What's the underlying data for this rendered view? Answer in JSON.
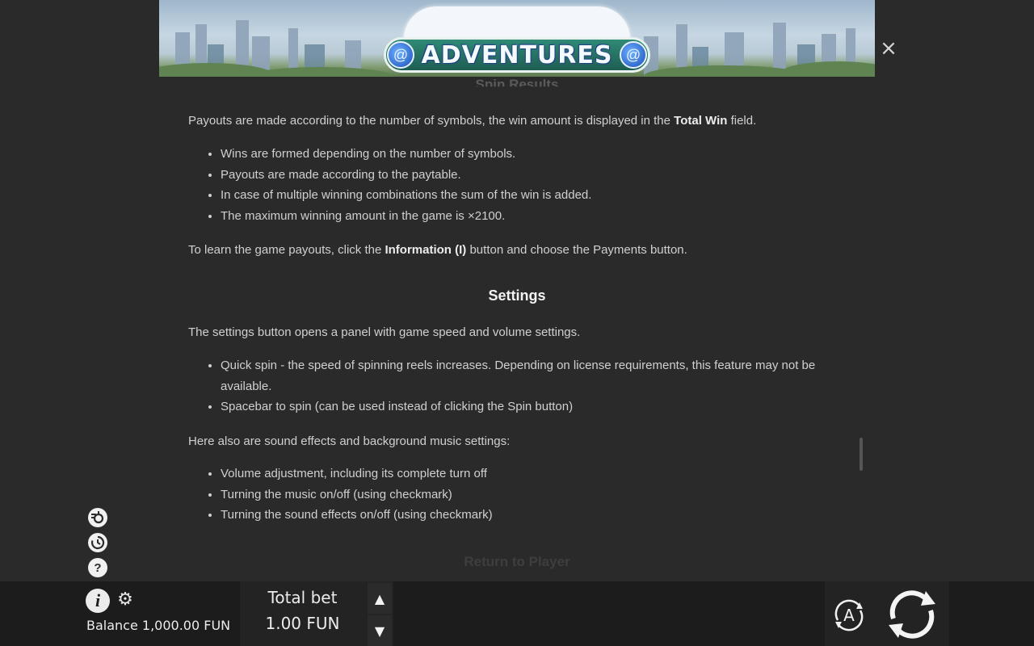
{
  "banner": {
    "logo_text": "ADVENTURES",
    "close_icon": "×"
  },
  "content": {
    "prev_heading": "Spin Results",
    "payouts_intro_before": "Payouts are made according to the number of symbols, the win amount is displayed in the ",
    "payouts_intro_bold": "Total Win",
    "payouts_intro_after": " field.",
    "payout_bullets": [
      "Wins are formed depending on the number of symbols.",
      "Payouts are made according to the paytable.",
      "In case of multiple winning combinations the sum of the win is added.",
      "The maximum winning amount in the game is ×2100."
    ],
    "learn_before": "To learn the game payouts, click the ",
    "learn_bold": "Information (I)",
    "learn_after": " button and choose the Payments button.",
    "settings_title": "Settings",
    "settings_intro": "The settings button opens a panel with game speed and volume settings.",
    "settings_bullets": [
      "Quick spin - the speed of spinning reels increases. Depending on license requirements, this feature may not be available.",
      "Spacebar to spin (can be used instead of clicking the Spin button)"
    ],
    "sound_intro": "Here also are sound effects and background music settings:",
    "sound_bullets": [
      "Volume adjustment, including its complete turn off",
      "Turning the music on/off (using checkmark)",
      "Turning the sound effects on/off (using checkmark)"
    ],
    "next_heading": "Return to Player"
  },
  "side_icons": {
    "turbo_icon": "turbo-spin-icon",
    "history_icon": "history-icon",
    "help_icon": "help-icon",
    "help_glyph": "?"
  },
  "bottom_bar": {
    "info_glyph": "i",
    "gear_glyph": "⚙",
    "balance_label": "Balance",
    "balance_value": "1,000.00 FUN",
    "bet_label": "Total bet",
    "bet_value": "1.00 FUN",
    "bet_up_glyph": "▲",
    "bet_down_glyph": "▼",
    "auto_glyph": "A"
  },
  "colors": {
    "background": "#2a2a2a",
    "bottom_bar": "#1c1c1c",
    "text": "#d0d0d0",
    "heading": "#f2f2f2"
  }
}
